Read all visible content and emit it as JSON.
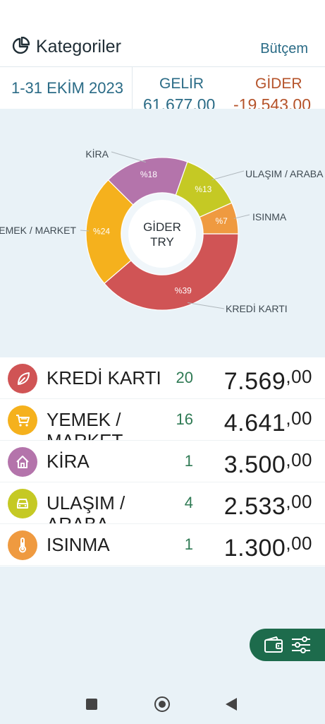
{
  "header": {
    "title": "Kategoriler",
    "budget_link": "Bütçem"
  },
  "summary": {
    "period": "1-31 EKİM 2023",
    "income_label": "GELİR",
    "income_value": "61.677,00",
    "expense_label": "GİDER",
    "expense_value": "-19.543,00"
  },
  "chart_data": {
    "type": "pie",
    "center_line1": "GİDER",
    "center_line2": "TRY",
    "series": [
      {
        "name": "KREDİ KARTI",
        "percent_label": "%39",
        "value": 7569,
        "color": "#d05455"
      },
      {
        "name": "YEMEK / MARKET",
        "percent_label": "%24",
        "value": 4641,
        "color": "#f5b11d"
      },
      {
        "name": "KİRA",
        "percent_label": "%18",
        "value": 3500,
        "color": "#b474ab"
      },
      {
        "name": "ULAŞIM / ARABA",
        "percent_label": "%13",
        "value": 2533,
        "color": "#c5c924"
      },
      {
        "name": "ISINMA",
        "percent_label": "%7",
        "value": 1300,
        "color": "#ef9a40"
      }
    ]
  },
  "categories": [
    {
      "name": "KREDİ KARTI",
      "count": "20",
      "amount_int": "7.569",
      "amount_dec": ",00",
      "color": "#d05455",
      "icon": "leaf-icon"
    },
    {
      "name": "YEMEK / MARKET",
      "count": "16",
      "amount_int": "4.641",
      "amount_dec": ",00",
      "color": "#f5b11d",
      "icon": "cart-icon"
    },
    {
      "name": "KİRA",
      "count": "1",
      "amount_int": "3.500",
      "amount_dec": ",00",
      "color": "#b474ab",
      "icon": "house-icon"
    },
    {
      "name": "ULAŞIM / ARABA",
      "count": "4",
      "amount_int": "2.533",
      "amount_dec": ",00",
      "color": "#c5c924",
      "icon": "car-icon"
    },
    {
      "name": "ISINMA",
      "count": "1",
      "amount_int": "1.300",
      "amount_dec": ",00",
      "color": "#ef9a40",
      "icon": "thermometer-icon"
    }
  ],
  "colors": {
    "accent": "#2a6b86",
    "expense": "#b5532a",
    "count": "#2f7a54",
    "fab": "#1d6b4c"
  }
}
